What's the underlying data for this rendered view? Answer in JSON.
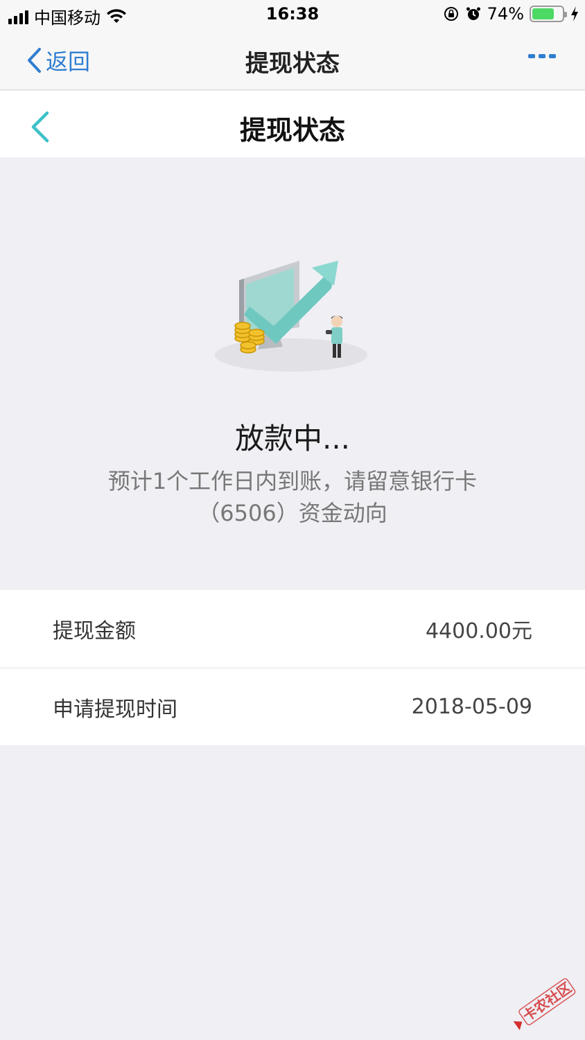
{
  "status_bar": {
    "carrier": "中国移动",
    "time": "16:38",
    "battery_percent": "74%",
    "battery_level": 0.74,
    "battery_color": "#4cd964"
  },
  "nav": {
    "back_label": "返回",
    "title": "提现状态",
    "more_icon": "ellipsis-icon",
    "accent": "#2f7dd0"
  },
  "inner_header": {
    "title": "提现状态",
    "back_icon": "chevron-left-icon",
    "back_color": "#3ec1c9"
  },
  "status": {
    "title": "放款中...",
    "description": "预计1个工作日内到账，请留意银行卡（6506）资金动向"
  },
  "details": [
    {
      "label": "提现金额",
      "value": "4400.00元"
    },
    {
      "label": "申请提现时间",
      "value": "2018-05-09"
    }
  ],
  "watermark": {
    "text": "卡农社区"
  }
}
